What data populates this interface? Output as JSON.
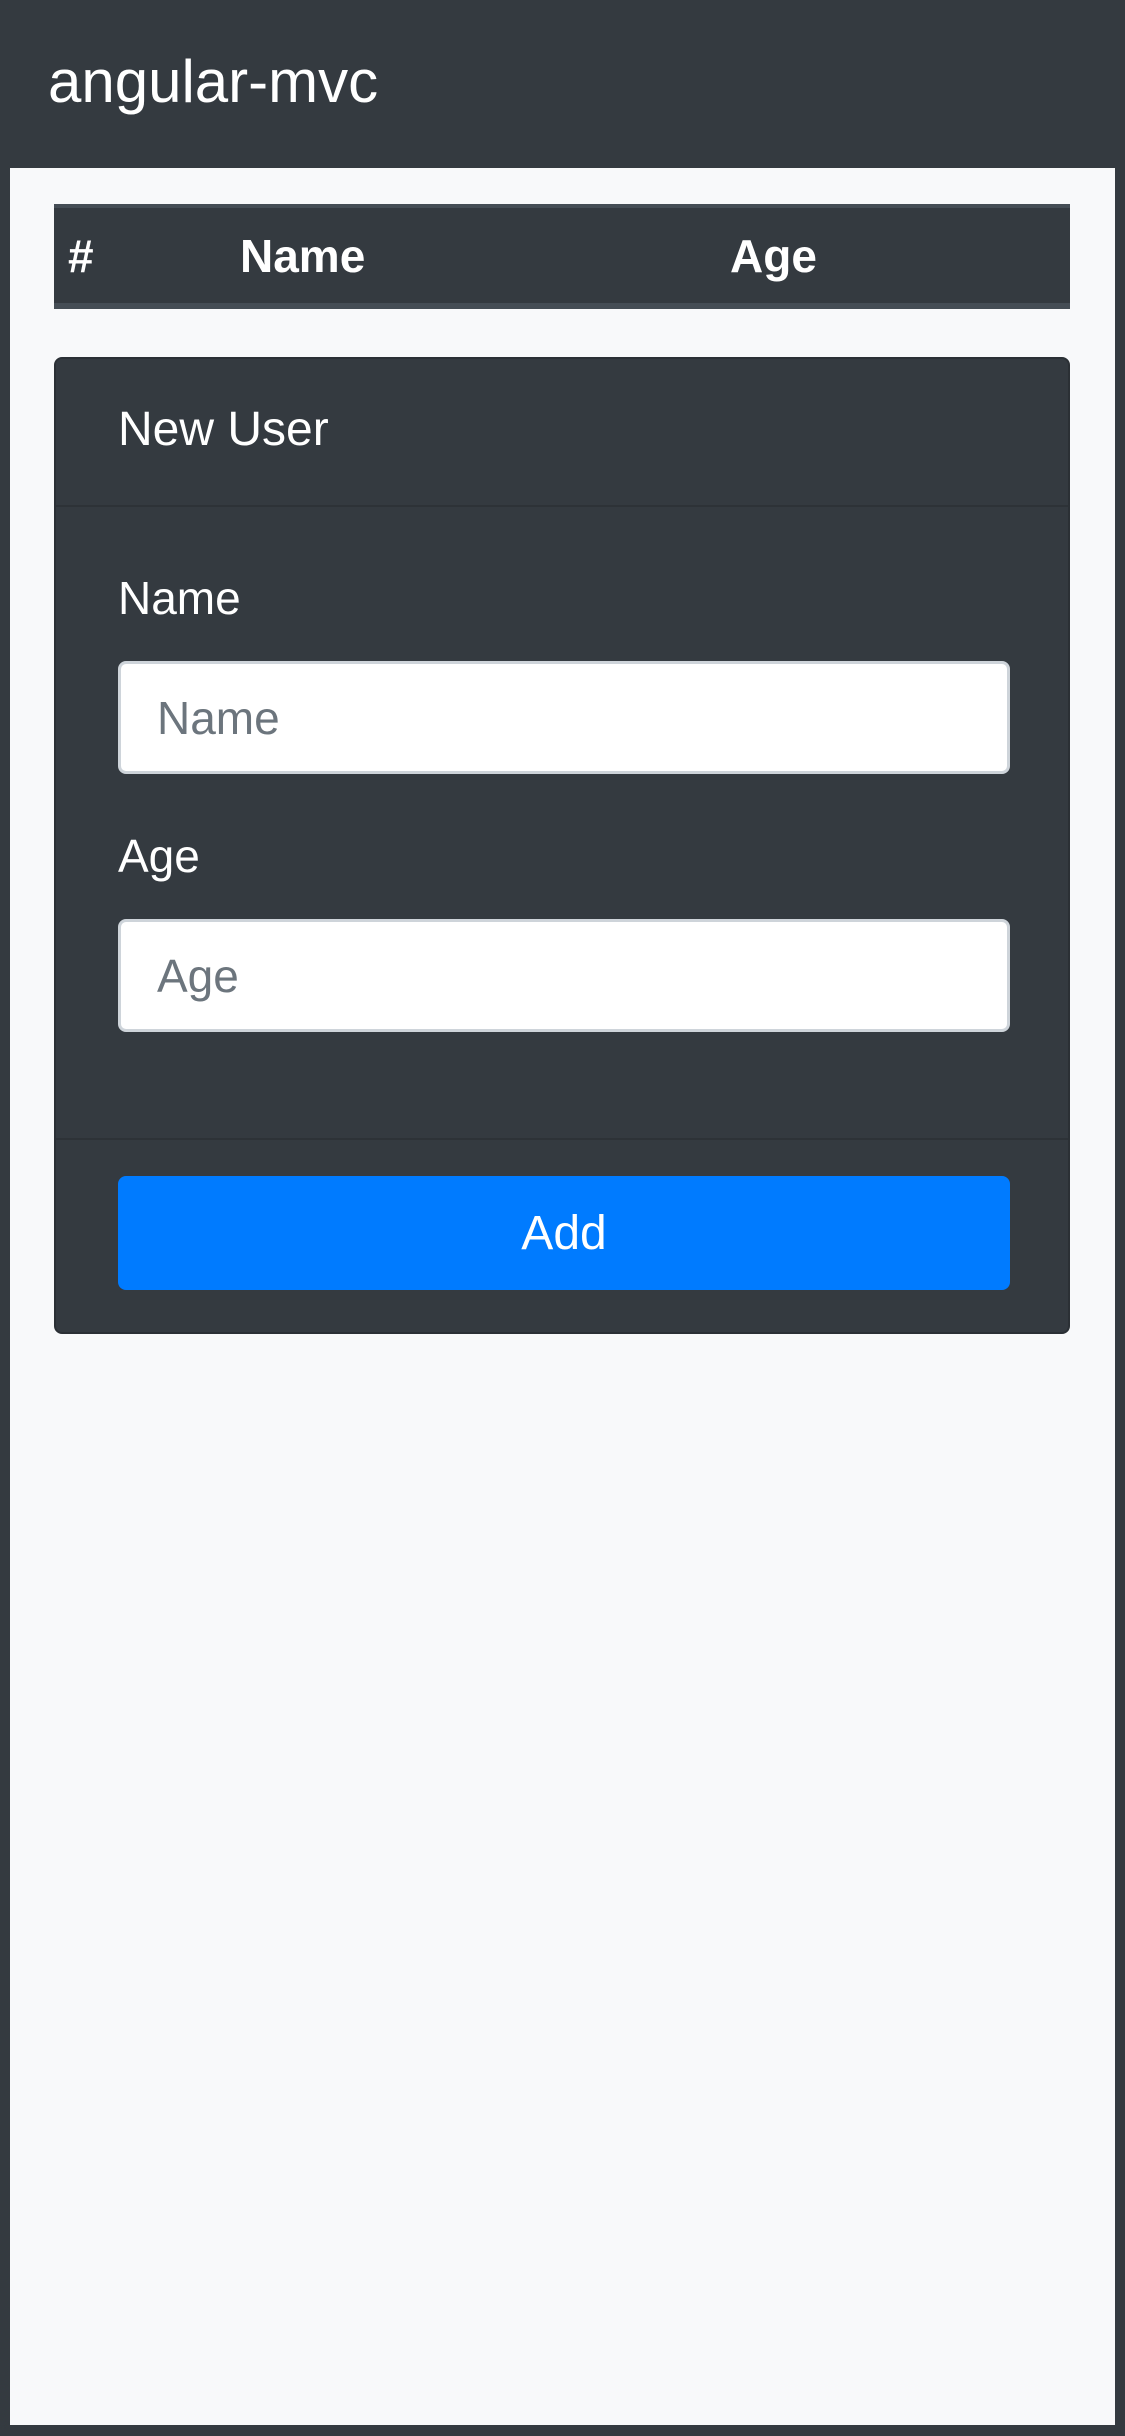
{
  "app": {
    "title": "angular-mvc"
  },
  "users_table": {
    "columns": [
      "#",
      "Name",
      "Age"
    ],
    "rows": []
  },
  "new_user_form": {
    "title": "New User",
    "fields": [
      {
        "label": "Name",
        "placeholder": "Name",
        "value": ""
      },
      {
        "label": "Age",
        "placeholder": "Age",
        "value": ""
      }
    ],
    "submit_label": "Add"
  },
  "colors": {
    "dark": "#343a40",
    "light": "#f8f9fa",
    "primary": "#007bff"
  }
}
